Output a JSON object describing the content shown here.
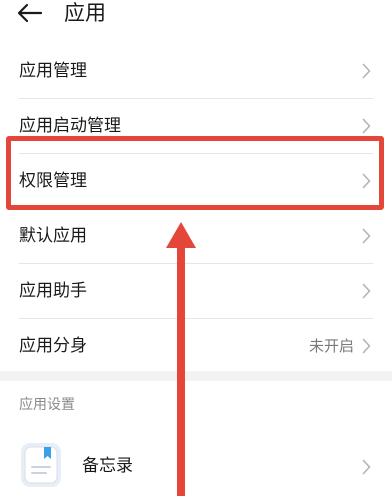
{
  "header": {
    "title": "应用"
  },
  "menu": {
    "items": [
      {
        "label": "应用管理",
        "value": ""
      },
      {
        "label": "应用启动管理",
        "value": ""
      },
      {
        "label": "权限管理",
        "value": ""
      },
      {
        "label": "默认应用",
        "value": ""
      },
      {
        "label": "应用助手",
        "value": ""
      },
      {
        "label": "应用分身",
        "value": "未开启"
      }
    ]
  },
  "settings": {
    "section_title": "应用设置",
    "apps": [
      {
        "label": "备忘录",
        "icon": "notes-app-icon"
      }
    ]
  },
  "annotation": {
    "color": "#e4463a",
    "highlighted_item": "权限管理"
  }
}
